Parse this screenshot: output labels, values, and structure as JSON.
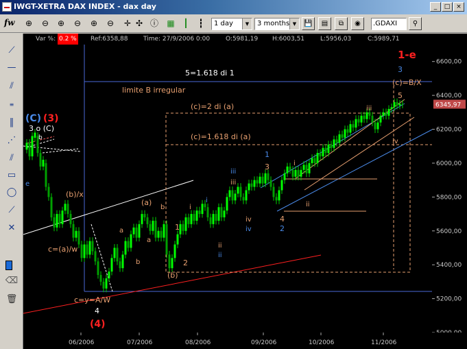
{
  "window": {
    "title": "IWGT-XETRA DAX INDEX  -  dax day",
    "min_label": "_",
    "max_label": "□",
    "close_label": "×"
  },
  "toolbar": {
    "brand": "fw",
    "period_value": "1 day",
    "range_value": "3 months",
    "ticker_value": ".GDAXI"
  },
  "infobar": {
    "var_label": "Var %:",
    "var_value": "0.2 %",
    "ref": "Ref:6358,88",
    "time": "Time:  27/9/2006 0:00",
    "open": "O:5981,19",
    "high": "H:6003,51",
    "low": "L:5956,03",
    "close": "C:5989,71"
  },
  "chart_data": {
    "type": "candlestick",
    "title": "",
    "ylim": [
      5000,
      6700
    ],
    "y_ticks": [
      "5000,00",
      "5200,00",
      "5400,00",
      "5600,00",
      "5800,00",
      "6000,00",
      "6200,00",
      "6400,00",
      "6600,00"
    ],
    "x_ticks": [
      "06/2006",
      "07/2006",
      "08/2006",
      "09/2006",
      "10/2006",
      "11/2006"
    ],
    "last_price": "6345,97",
    "annotations": {
      "wave_main": "1-e",
      "wave_3_blue": "3",
      "c_bx": "(c)=B/X",
      "five": "5",
      "fib_label": "5=1.618 di 1",
      "limite": "limite B irregular",
      "c2a": "(c)=2 di (a)",
      "c1618": "(c)=1.618 di (a)",
      "C": "(C)",
      "three": "(3)",
      "three_p_c": "3 o (C)",
      "b_top": "b",
      "e_left": "e",
      "bx": "(b)/x",
      "caw": "c=(a)/w",
      "cyaw": "c=y=A/W",
      "four": "4",
      "four_red": "(4)",
      "a1": "a",
      "b1": "b",
      "a_paren": "(a)",
      "b2": "b",
      "a2": "a",
      "one": "1",
      "two": "2",
      "b_paren": "(b)",
      "i1": "i",
      "i2": "i",
      "ii1": "ii",
      "ii2": "ii",
      "iii1": "iii",
      "iii2": "iii",
      "iv1": "iv",
      "iv2": "iv",
      "one_b": "1",
      "three_b": "3",
      "four_b": "4",
      "two_b": "2",
      "i3": "i",
      "ii3": "ii",
      "iii3": "iii",
      "iv3": "iv"
    }
  }
}
